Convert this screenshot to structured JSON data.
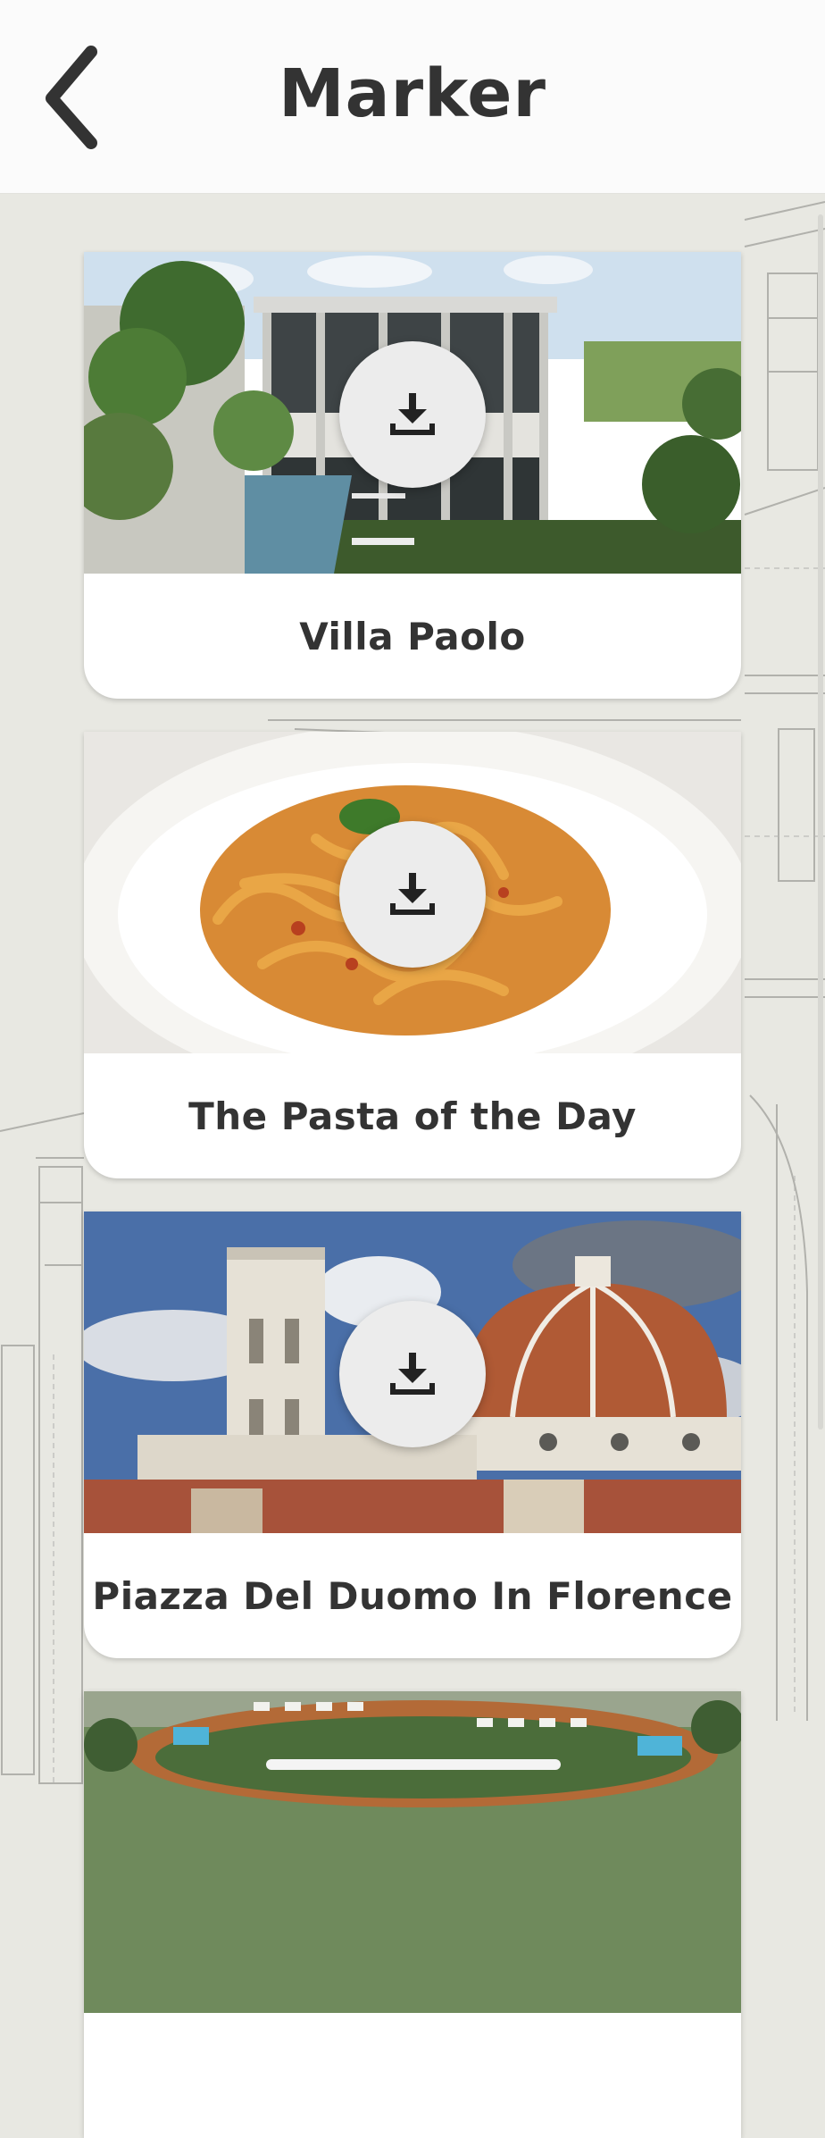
{
  "header": {
    "title": "Marker",
    "back_icon": "chevron-left-icon"
  },
  "cards": [
    {
      "title": "Villa Paolo",
      "image": "villa-image",
      "action_icon": "download-icon"
    },
    {
      "title": "The Pasta of the Day",
      "image": "pasta-image",
      "action_icon": "download-icon"
    },
    {
      "title": "Piazza Del Duomo In Florence",
      "image": "duomo-image",
      "action_icon": "download-icon"
    },
    {
      "title": "",
      "image": "resort-image",
      "action_icon": "download-icon"
    }
  ],
  "colors": {
    "background": "#e8e8e2",
    "card": "#ffffff",
    "text": "#333333",
    "button": "#ececec"
  }
}
